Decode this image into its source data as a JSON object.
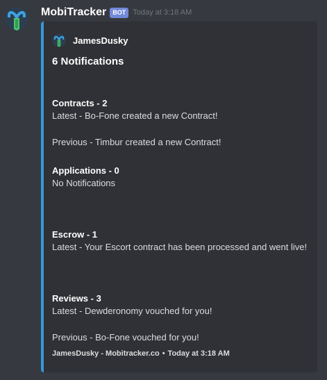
{
  "message": {
    "author": "MobiTracker",
    "bot_tag": "BOT",
    "timestamp": "Today at 3:18 AM"
  },
  "embed": {
    "accent_color": "#3498db",
    "author_name": "JamesDusky",
    "title": "6 Notifications",
    "fields": [
      {
        "name": "Contracts - 2",
        "lines": [
          "Latest - Bo-Fone created a new Contract!",
          "",
          "Previous - Timbur created a new Contract!"
        ]
      },
      {
        "name": "Applications - 0",
        "lines": [
          "No Notifications"
        ]
      },
      {
        "name": "Escrow - 1",
        "lines": [
          "Latest - Your Escort contract has been processed and went live!"
        ]
      },
      {
        "name": "Reviews - 3",
        "lines": [
          "Latest - Dewderonomy vouched for you!",
          "",
          "Previous - Bo-Fone vouched for you!"
        ]
      }
    ],
    "footer": {
      "text": "JamesDusky - Mobitracker.co",
      "separator": "•",
      "timestamp": "Today at 3:18 AM"
    }
  },
  "icons": {
    "avatar": "mobitracker-logo-icon",
    "author_icon": "mobitracker-logo-icon"
  }
}
